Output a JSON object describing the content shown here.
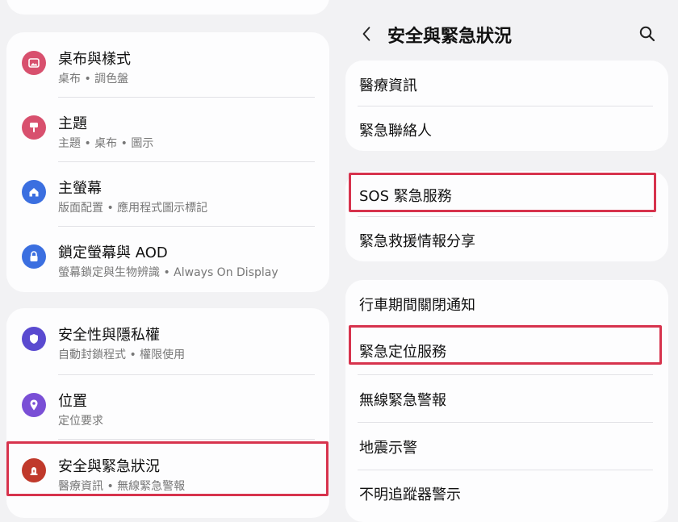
{
  "left": {
    "items": [
      {
        "title": "桌布與樣式",
        "subtitle": "桌布 • 調色盤",
        "icon": "wallpaper-icon",
        "color": "#d8506e"
      },
      {
        "title": "主題",
        "subtitle": "主題 • 桌布 • 圖示",
        "icon": "theme-brush-icon",
        "color": "#d8506e"
      },
      {
        "title": "主螢幕",
        "subtitle": "版面配置 • 應用程式圖示標記",
        "icon": "home-icon",
        "color": "#3b6fe0"
      },
      {
        "title": "鎖定螢幕與 AOD",
        "subtitle": "螢幕鎖定與生物辨識 • Always On Display",
        "icon": "lock-icon",
        "color": "#3b6fe0"
      },
      {
        "title": "安全性與隱私權",
        "subtitle": "自動封鎖程式 • 權限使用",
        "icon": "shield-icon",
        "color": "#5a4ad0"
      },
      {
        "title": "位置",
        "subtitle": "定位要求",
        "icon": "location-pin-icon",
        "color": "#7a4fd6"
      },
      {
        "title": "安全與緊急狀況",
        "subtitle": "醫療資訊 • 無線緊急警報",
        "icon": "emergency-siren-icon",
        "color": "#c0392b"
      }
    ]
  },
  "right": {
    "header": {
      "title": "安全與緊急狀況",
      "back_icon": "back-chevron-icon",
      "search_icon": "search-icon"
    },
    "items": [
      {
        "label": "醫療資訊"
      },
      {
        "label": "緊急聯絡人"
      },
      {
        "label": "SOS 緊急服務"
      },
      {
        "label": "緊急救援情報分享"
      },
      {
        "label": "行車期間關閉通知"
      },
      {
        "label": "緊急定位服務"
      },
      {
        "label": "無線緊急警報"
      },
      {
        "label": "地震示警"
      },
      {
        "label": "不明追蹤器警示"
      }
    ]
  },
  "colors": {
    "highlight": "#d7334d",
    "background": "#f2f2f4",
    "card": "#fdfdfe"
  }
}
